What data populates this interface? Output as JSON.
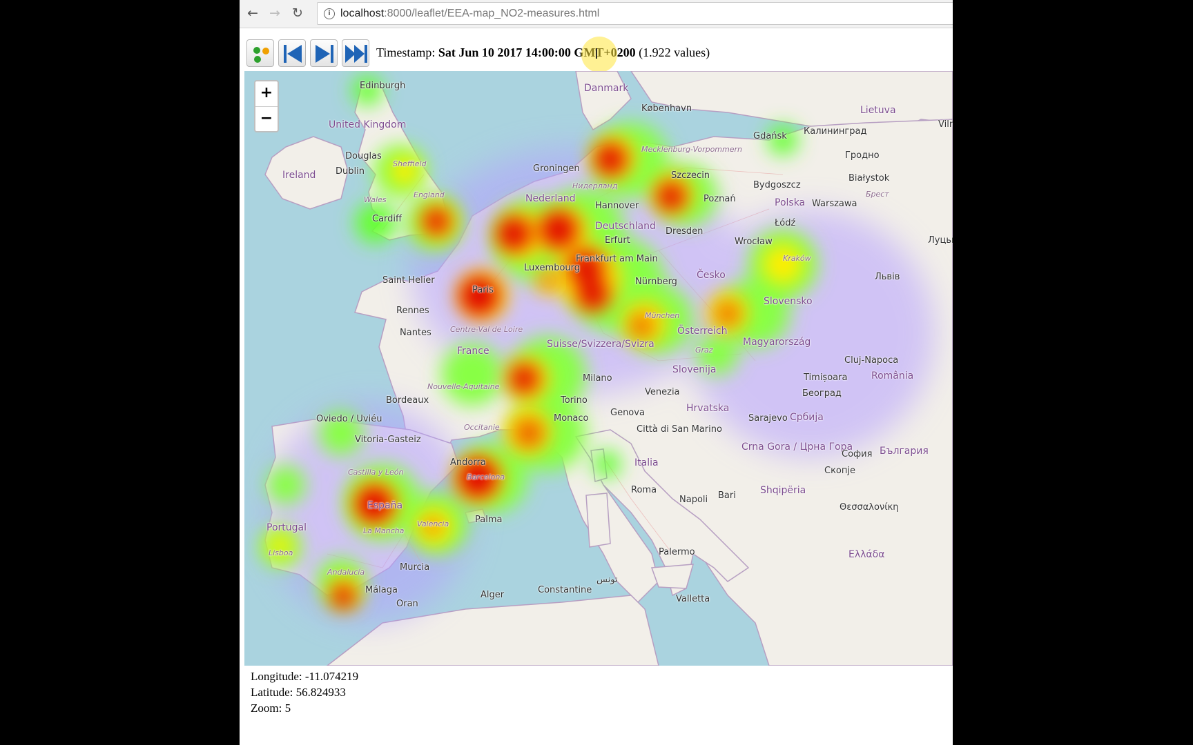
{
  "browser": {
    "url_host": "localhost",
    "url_rest": ":8000/leaflet/EEA-map_NO2-measures.html",
    "back_icon": "←",
    "forward_icon": "→",
    "reload_icon": "↻",
    "info_icon": "i"
  },
  "toolbar": {
    "timestamp_label": "Timestamp:",
    "timestamp_value": "Sat Jun 10 2017 14:00:00 GMT+0200",
    "values_count": "(1.922 values)"
  },
  "map": {
    "zoom_in": "+",
    "zoom_out": "−",
    "places": [
      "Edinburgh",
      "United Kingdom",
      "Douglas",
      "Dublin",
      "Ireland",
      "Sheffield",
      "England",
      "Wales",
      "Cardiff",
      "Danmark",
      "København",
      "Lietuva",
      "Gdańsk",
      "Калининград",
      "Гродно",
      "Vilnius",
      "Mecklenburg-Vorpommern",
      "Groningen",
      "Szczecin",
      "Bydgoszcz",
      "Białystok",
      "Нидерланд",
      "Nederland",
      "Hannover",
      "Poznań",
      "Polska",
      "Warszawa",
      "Брест",
      "Deutschland",
      "Erfurt",
      "Dresden",
      "Wrocław",
      "Łódź",
      "Луцьк",
      "Frankfurt am Main",
      "Luxembourg",
      "Saint Helier",
      "Česko",
      "Kraków",
      "Nürnberg",
      "Львів",
      "Paris",
      "Rennes",
      "Slovensko",
      "München",
      "Österreich",
      "Nantes",
      "Centre-Val de Loire",
      "France",
      "Suisse/Svizzera/Svizra",
      "Magyarország",
      "Cluj-Napoca",
      "Graz",
      "Slovenija",
      "Timișoara",
      "România",
      "Milano",
      "Venezia",
      "Hrvatska",
      "Београд",
      "Bordeaux",
      "Nouvelle-Aquitaine",
      "Torino",
      "Genova",
      "Sarajevo",
      "Србија",
      "Monaco",
      "Occitanie",
      "Città di San Marino",
      "Oviedo / Uviéu",
      "Vitoria-Gasteiz",
      "Andorra",
      "Italia",
      "Crna Gora / Црна Гора",
      "София",
      "Скопје",
      "Castilla y León",
      "Barcelona",
      "Roma",
      "Bari",
      "Shqipëria",
      "Portugal",
      "España",
      "Palma",
      "Napoli",
      "Θεσσαλονίκη",
      "Lisboa",
      "La Mancha",
      "Valencia",
      "Murcia",
      "Palermo",
      "Ελλάδα",
      "Andalucía",
      "Málaga",
      "Alger",
      "Constantine",
      "تونس",
      "Valletta",
      "Oran",
      "България"
    ]
  },
  "position": {
    "longitude_label": "Longitude:",
    "longitude": "-11.074219",
    "latitude_label": "Latitude:",
    "latitude": "56.824933",
    "zoom_label": "Zoom:",
    "zoom": "5"
  },
  "colors": {
    "sea": "#aad3df",
    "land": "#f2efe9",
    "heat_low": "#00ff00",
    "heat_mid": "#ffff00",
    "heat_high": "#e00000"
  }
}
